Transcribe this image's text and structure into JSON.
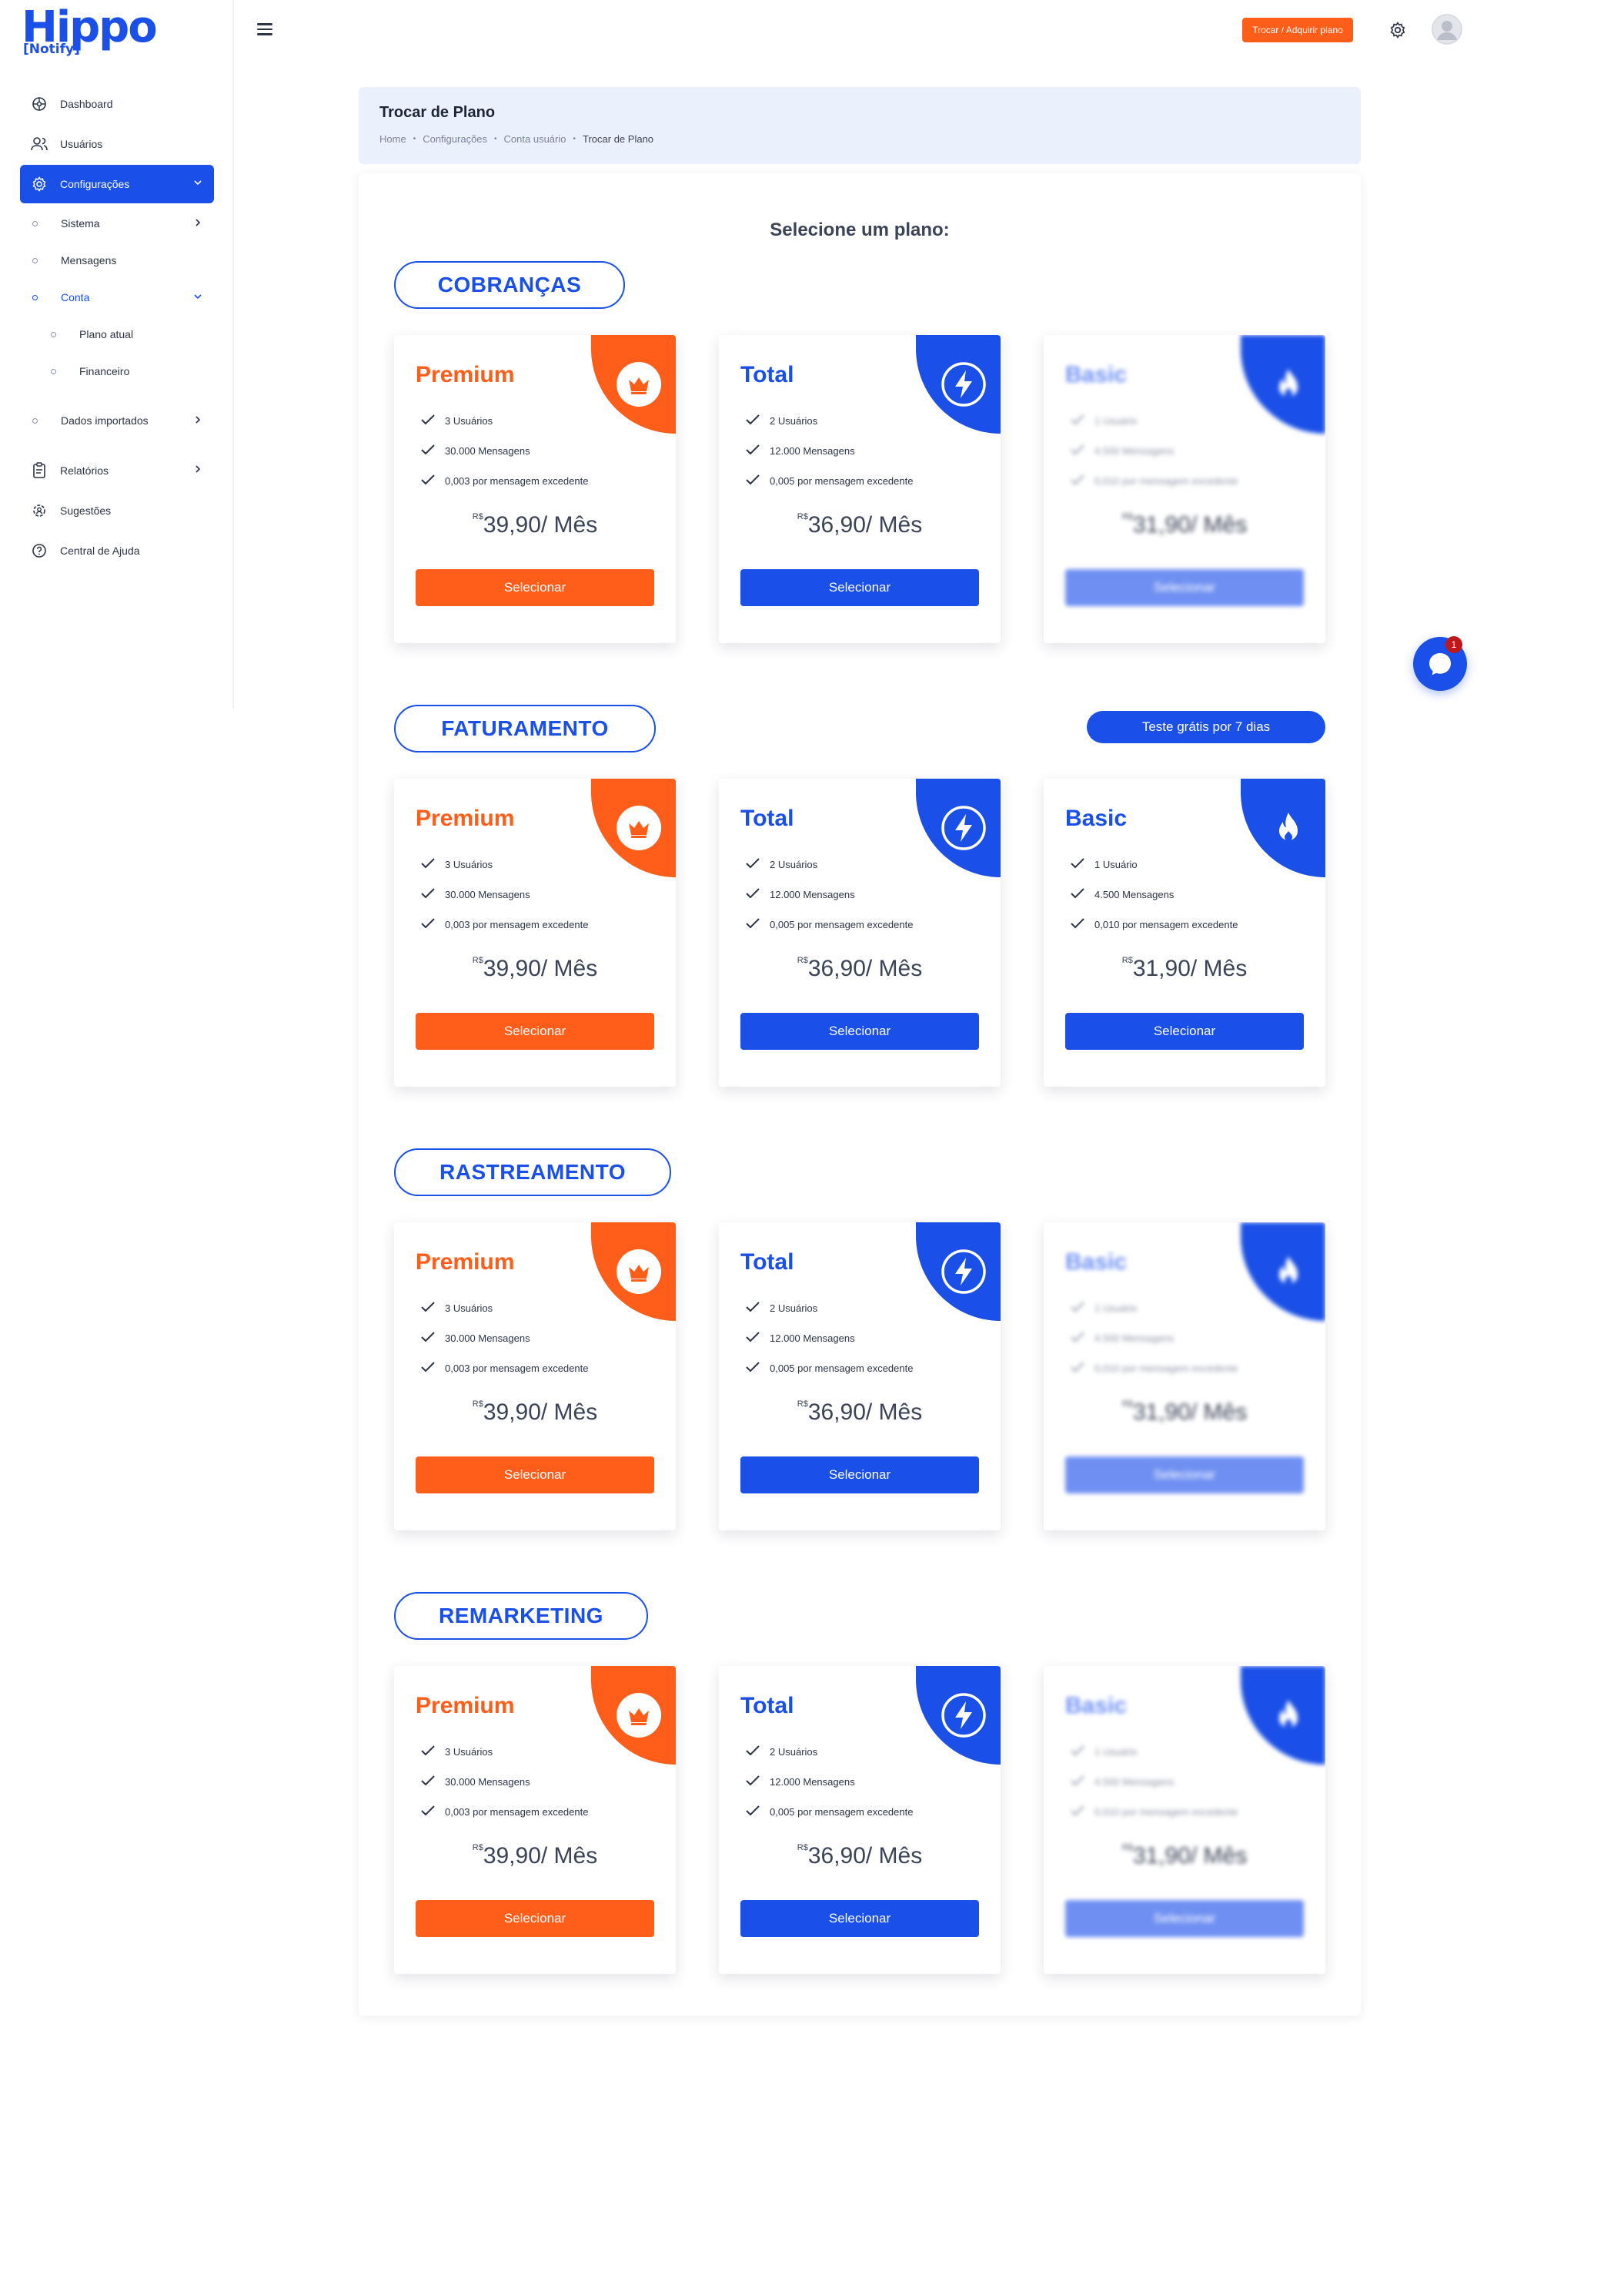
{
  "app": {
    "logo_main": "Hippo",
    "logo_sub": "[Notify]"
  },
  "colors": {
    "primary": "#1a4fe8",
    "orange": "#ff5e1a",
    "muted_blue": "#6f90f2",
    "header_bg": "#eaf1fd"
  },
  "sidebar": {
    "items": [
      {
        "label": "Dashboard",
        "icon": "dashboard-icon"
      },
      {
        "label": "Usuários",
        "icon": "users-icon"
      },
      {
        "label": "Configurações",
        "icon": "gear-icon"
      }
    ],
    "config_sub": {
      "sistema": "Sistema",
      "mensagens": "Mensagens",
      "conta": "Conta",
      "plano_atual": "Plano atual",
      "financeiro": "Financeiro",
      "dados_importados": "Dados importados"
    },
    "bottom_items": [
      {
        "label": "Relatórios",
        "icon": "clipboard-icon"
      },
      {
        "label": "Sugestões",
        "icon": "cog-user-icon"
      },
      {
        "label": "Central de Ajuda",
        "icon": "help-icon"
      }
    ]
  },
  "topbar": {
    "change_plan_button": "Trocar / Adquirir plano"
  },
  "header": {
    "title": "Trocar de Plano",
    "breadcrumb": [
      "Home",
      "Configurações",
      "Conta usuário",
      "Trocar de Plano"
    ]
  },
  "main": {
    "select_title": "Selecione um plano:",
    "trial_button": "Teste grátis por 7 dias",
    "sections": [
      {
        "name": "COBRANÇAS",
        "basic_disabled": true
      },
      {
        "name": "FATURAMENTO",
        "basic_disabled": false
      },
      {
        "name": "RASTREAMENTO",
        "basic_disabled": true
      },
      {
        "name": "REMARKETING",
        "basic_disabled": true
      }
    ],
    "plans": [
      {
        "name": "Premium",
        "icon": "crown-icon",
        "color": "#ff5e1a",
        "features": [
          "3 Usuários",
          "30.000 Mensagens",
          "0,003 por mensagem excedente"
        ],
        "currency": "R$",
        "price": "39,90/ Mês",
        "button": "Selecionar"
      },
      {
        "name": "Total",
        "icon": "lightning-icon",
        "color": "#1a4fe8",
        "features": [
          "2 Usuários",
          "12.000 Mensagens",
          "0,005 por mensagem excedente"
        ],
        "currency": "R$",
        "price": "36,90/ Mês",
        "button": "Selecionar"
      },
      {
        "name": "Basic",
        "icon": "fire-icon",
        "color": "#1a4fe8",
        "features": [
          "1 Usuário",
          "4.500 Mensagens",
          "0,010 por mensagem excedente"
        ],
        "currency": "R$",
        "price": "31,90/ Mês",
        "button": "Selecionar"
      }
    ]
  },
  "chat": {
    "badge": "1",
    "icon": "chat-icon"
  }
}
